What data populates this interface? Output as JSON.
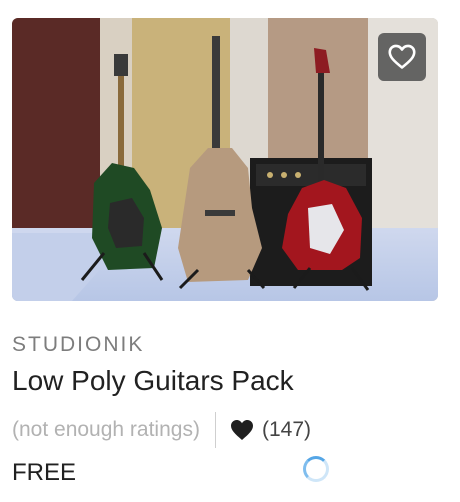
{
  "asset": {
    "publisher": "STUDIONIK",
    "title": "Low Poly Guitars Pack",
    "rating_text": "(not enough ratings)",
    "favorites_count": "(147)",
    "price": "FREE"
  },
  "icons": {
    "favorite_button": "heart-outline-icon",
    "favorites": "heart-filled-icon",
    "loading": "loading-spinner-icon"
  },
  "colors": {
    "accent": "#55a6e6",
    "text_primary": "#212121",
    "text_muted": "#b2b2b2"
  }
}
